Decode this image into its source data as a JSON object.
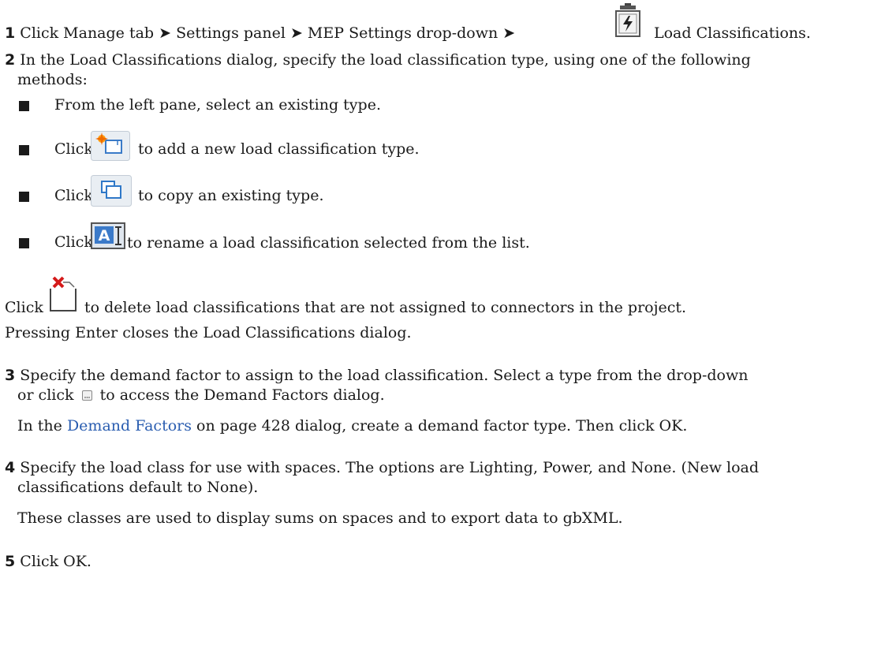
{
  "steps": {
    "s1": {
      "num": "1",
      "pre": "Click Manage tab ➤ Settings panel ➤ MEP Settings drop-down ➤",
      "post": "Load Classifications.",
      "icon": "load-classifications-icon"
    },
    "s2": {
      "num": "2",
      "line1": "In the Load Classifications dialog, specify the load classification type, using one of the following",
      "line2": "methods:",
      "bullets": [
        {
          "text": "From the left pane, select an existing type."
        },
        {
          "pre": "Click",
          "post": "to add a new load classification type.",
          "icon": "new-type-icon"
        },
        {
          "pre": "Click",
          "post": "to copy an existing type.",
          "icon": "duplicate-icon"
        },
        {
          "pre": "Click",
          "post": "to rename a load classification selected from the list.",
          "icon": "rename-icon"
        }
      ],
      "delete_pre": "Click",
      "delete_post": "to delete load classifications that are not assigned to connectors in the project.",
      "delete_icon": "delete-icon",
      "enter_note": "Pressing Enter closes the Load Classifications dialog."
    },
    "s3": {
      "num": "3",
      "line1": "Specify the demand factor to assign to the load classification. Select a type from the drop-down",
      "line2_pre": "or click",
      "line2_post": "to access the Demand Factors dialog.",
      "browse_icon": "browse-button-icon",
      "note_pre": "In the",
      "note_link": "Demand Factors",
      "note_post": "on page 428 dialog, create a demand factor type. Then click OK."
    },
    "s4": {
      "num": "4",
      "line1": "Specify the load class for use with spaces. The options are Lighting, Power, and None. (New load",
      "line2": "classifications default to None).",
      "note": "These classes are used to display sums on spaces and to export data to gbXML."
    },
    "s5": {
      "num": "5",
      "text": "Click OK."
    }
  },
  "colors": {
    "text": "#1a1a1a",
    "link": "#2a5db0"
  }
}
